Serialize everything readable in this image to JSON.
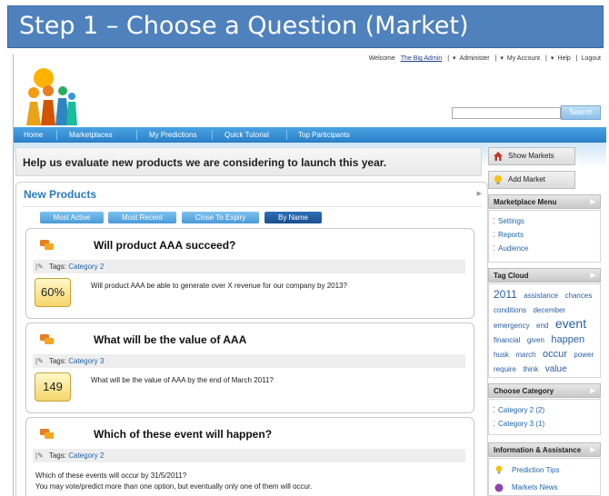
{
  "banner": {
    "title": "Step 1 – Choose a Question (Market)"
  },
  "header": {
    "welcome": "Welcome",
    "username": "The Big Admin",
    "links": [
      "Administer",
      "My Account",
      "Help",
      "Logout"
    ],
    "search_button": "Search"
  },
  "nav": {
    "items": [
      "Home",
      "Marketplaces",
      "My Predictions",
      "Quick Tutorial",
      "Top Participants"
    ]
  },
  "headline": "Help us evaluate new products we are considering to launch this year.",
  "new_products": {
    "title": "New Products",
    "tabs": [
      {
        "label": "Most Active",
        "selected": false
      },
      {
        "label": "Most Recent",
        "selected": false
      },
      {
        "label": "Close To Expiry",
        "selected": false
      },
      {
        "label": "By Name",
        "selected": true
      }
    ],
    "cards": [
      {
        "title": "Will product AAA succeed?",
        "tags_label": "Tags:",
        "tag": "Category 2",
        "value": "60%",
        "description": "Will product AAA be able to generate over X revenue for our company by 2013?"
      },
      {
        "title": "What will be the value of AAA",
        "tags_label": "Tags:",
        "tag": "Category 3",
        "value": "149",
        "description": "What will be the value of AAA by the end of March 2011?"
      },
      {
        "title": "Which of these event will happen?",
        "tags_label": "Tags:",
        "tag": "Category 2",
        "description_lines": [
          "Which of these events will occur by 31/5/2011?",
          "You may vote/predict more than one option, but eventually only one of them will occur."
        ]
      }
    ]
  },
  "sidebar": {
    "show_markets": "Show Markets",
    "add_market": "Add Market",
    "marketplace_menu": {
      "title": "Marketplace Menu",
      "items": [
        "Settings",
        "Reports",
        "Audience"
      ]
    },
    "tag_cloud": {
      "title": "Tag Cloud",
      "tags": [
        {
          "text": "2011",
          "size": 12
        },
        {
          "text": "assistance",
          "size": 8
        },
        {
          "text": "chances",
          "size": 8
        },
        {
          "text": "conditions",
          "size": 8
        },
        {
          "text": "december",
          "size": 8
        },
        {
          "text": "emergency",
          "size": 8
        },
        {
          "text": "end",
          "size": 8
        },
        {
          "text": "event",
          "size": 14
        },
        {
          "text": "financial",
          "size": 8
        },
        {
          "text": "given",
          "size": 8
        },
        {
          "text": "happen",
          "size": 11
        },
        {
          "text": "husk",
          "size": 8
        },
        {
          "text": "march",
          "size": 8
        },
        {
          "text": "occur",
          "size": 11
        },
        {
          "text": "power",
          "size": 8
        },
        {
          "text": "require",
          "size": 8
        },
        {
          "text": "think",
          "size": 8
        },
        {
          "text": "value",
          "size": 10
        }
      ]
    },
    "choose_category": {
      "title": "Choose Category",
      "items": [
        "Category 2 (2)",
        "Category 3 (1)"
      ]
    },
    "info": {
      "title": "Information & Assistance",
      "items": [
        "Prediction Tips",
        "Markets News"
      ]
    }
  },
  "colors": {
    "banner": "#4f81bd",
    "nav": "#2a7fc7",
    "accent_blue": "#2b7abf",
    "value_badge": "#f5d56a"
  }
}
